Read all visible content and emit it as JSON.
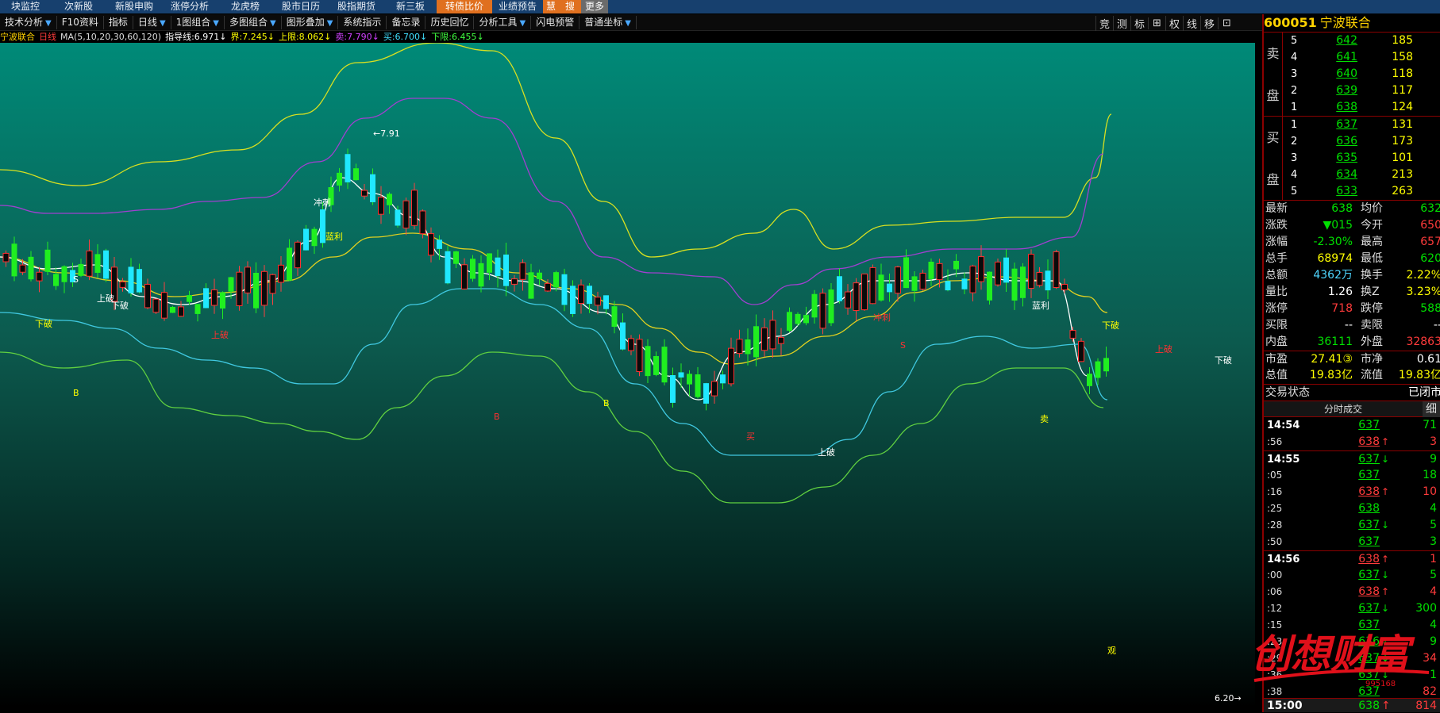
{
  "top_menu": [
    {
      "label": "块监控",
      "w": 64,
      "s": ""
    },
    {
      "label": "次新股",
      "w": 70,
      "s": ""
    },
    {
      "label": "新股申购",
      "w": 70,
      "s": ""
    },
    {
      "label": "涨停分析",
      "w": 70,
      "s": ""
    },
    {
      "label": "龙虎榜",
      "w": 70,
      "s": ""
    },
    {
      "label": "股市日历",
      "w": 70,
      "s": ""
    },
    {
      "label": "股指期货",
      "w": 70,
      "s": ""
    },
    {
      "label": "新三板",
      "w": 66,
      "s": ""
    },
    {
      "label": "转债比价",
      "w": 70,
      "s": "orange"
    },
    {
      "label": "业绩预告",
      "w": 64,
      "s": ""
    },
    {
      "label": "慧",
      "w": 20,
      "s": "orange"
    },
    {
      "label": "搜",
      "w": 28,
      "s": "orange"
    },
    {
      "label": "更多",
      "w": 34,
      "s": "gray"
    }
  ],
  "toolbar": [
    {
      "label": "技术分析",
      "arr": true
    },
    {
      "label": "F10资料",
      "arr": false
    },
    {
      "label": "指标",
      "arr": false
    },
    {
      "label": "日线",
      "arr": true
    },
    {
      "label": "1图组合",
      "arr": true
    },
    {
      "label": "多图组合",
      "arr": true
    },
    {
      "label": "图形叠加",
      "arr": true
    },
    {
      "label": "系统指示",
      "arr": false
    },
    {
      "label": "备忘录",
      "arr": false
    },
    {
      "label": "历史回忆",
      "arr": false
    },
    {
      "label": "分析工具",
      "arr": true
    },
    {
      "label": "闪电预警",
      "arr": false
    },
    {
      "label": "普通坐标",
      "arr": true
    }
  ],
  "right_tools": [
    "竞",
    "测",
    "标",
    "⊞",
    "权",
    "线",
    "移",
    "⊡"
  ],
  "indicator_bar": {
    "name": "宁波联合",
    "period": "日线",
    "ma": "MA(5,10,20,30,60,120)",
    "items": [
      {
        "label": "指导线:",
        "value": "6.971",
        "arrow": "↓",
        "color": "#ffffff"
      },
      {
        "label": "界:",
        "value": "7.245",
        "arrow": "↓",
        "color": "#ffff00"
      },
      {
        "label": "上限:",
        "value": "8.062",
        "arrow": "↓",
        "color": "#ffff00"
      },
      {
        "label": "卖:",
        "value": "7.790",
        "arrow": "↓",
        "color": "#d040ff"
      },
      {
        "label": "买:",
        "value": "6.700",
        "arrow": "↓",
        "color": "#40e0ff"
      },
      {
        "label": "下限:",
        "value": "6.455",
        "arrow": "↓",
        "color": "#40ff40"
      }
    ]
  },
  "chart_data": {
    "type": "candlestick",
    "symbol": "600051",
    "name": "宁波联合",
    "period": "日线",
    "annotations": {
      "high_marker": "7.91",
      "low_marker": "6.20",
      "labels": [
        "上破",
        "下破",
        "S",
        "B",
        "买",
        "卖",
        "冲刺",
        "蓝利",
        "观"
      ]
    },
    "ylim": [
      6.2,
      8.2
    ]
  },
  "quote": {
    "code": "600051",
    "name": "宁波联合",
    "sell": [
      {
        "i": "5",
        "p": "642",
        "v": "185"
      },
      {
        "i": "4",
        "p": "641",
        "v": "158"
      },
      {
        "i": "3",
        "p": "640",
        "v": "118"
      },
      {
        "i": "2",
        "p": "639",
        "v": "117"
      },
      {
        "i": "1",
        "p": "638",
        "v": "124"
      }
    ],
    "buy": [
      {
        "i": "1",
        "p": "637",
        "v": "131"
      },
      {
        "i": "2",
        "p": "636",
        "v": "173"
      },
      {
        "i": "3",
        "p": "635",
        "v": "101"
      },
      {
        "i": "4",
        "p": "634",
        "v": "213"
      },
      {
        "i": "5",
        "p": "633",
        "v": "263"
      }
    ],
    "sell_label": [
      "卖",
      "盘"
    ],
    "buy_label": [
      "买",
      "盘"
    ],
    "stats": [
      {
        "l1": "最新",
        "v1": "638",
        "c1": "green",
        "l2": "均价",
        "v2": "632",
        "c2": "green"
      },
      {
        "l1": "涨跌",
        "v1": "▼015",
        "c1": "green",
        "l2": "今开",
        "v2": "650",
        "c2": "red"
      },
      {
        "l1": "涨幅",
        "v1": "-2.30%",
        "c1": "green",
        "l2": "最高",
        "v2": "657",
        "c2": "red"
      },
      {
        "l1": "总手",
        "v1": "68974",
        "c1": "yellow",
        "l2": "最低",
        "v2": "620",
        "c2": "green"
      },
      {
        "l1": "总额",
        "v1": "4362万",
        "c1": "cyan",
        "l2": "换手",
        "v2": "2.22%",
        "c2": "yellow"
      },
      {
        "l1": "量比",
        "v1": "1.26",
        "c1": "white",
        "l2": "换Z",
        "v2": "3.23%",
        "c2": "yellow"
      },
      {
        "l1": "涨停",
        "v1": "718",
        "c1": "red",
        "l2": "跌停",
        "v2": "588",
        "c2": "green"
      },
      {
        "l1": "买限",
        "v1": "--",
        "c1": "white",
        "l2": "卖限",
        "v2": "--",
        "c2": "white"
      },
      {
        "l1": "内盘",
        "v1": "36111",
        "c1": "green",
        "l2": "外盘",
        "v2": "32863",
        "c2": "red"
      },
      {
        "l1": "市盈",
        "v1": "27.41③",
        "c1": "yellow",
        "l2": "市净",
        "v2": "0.61",
        "c2": "white"
      },
      {
        "l1": "总值",
        "v1": "19.83亿",
        "c1": "yellow",
        "l2": "流值",
        "v2": "19.83亿",
        "c2": "yellow"
      },
      {
        "l1": "交易状态",
        "v1": "",
        "c1": "white",
        "l2": "",
        "v2": "已闭市",
        "c2": "white"
      }
    ],
    "ticks_title": "分时成交",
    "ticks_btn": "细",
    "ticks": [
      {
        "t": "14:54",
        "big": true,
        "p": "637",
        "c": "green",
        "a": "",
        "v": "71",
        "vc": "green"
      },
      {
        "t": ":56",
        "big": false,
        "p": "638",
        "c": "red",
        "a": "↑",
        "v": "3",
        "vc": "red"
      },
      {
        "t": "14:55",
        "big": true,
        "p": "637",
        "c": "green",
        "a": "↓",
        "v": "9",
        "vc": "green"
      },
      {
        "t": ":05",
        "big": false,
        "p": "637",
        "c": "green",
        "a": "",
        "v": "18",
        "vc": "green"
      },
      {
        "t": ":16",
        "big": false,
        "p": "638",
        "c": "red",
        "a": "↑",
        "v": "10",
        "vc": "red"
      },
      {
        "t": ":25",
        "big": false,
        "p": "638",
        "c": "green",
        "a": "",
        "v": "4",
        "vc": "green"
      },
      {
        "t": ":28",
        "big": false,
        "p": "637",
        "c": "green",
        "a": "↓",
        "v": "5",
        "vc": "green"
      },
      {
        "t": ":50",
        "big": false,
        "p": "637",
        "c": "green",
        "a": "",
        "v": "3",
        "vc": "green"
      },
      {
        "t": "14:56",
        "big": true,
        "p": "638",
        "c": "red",
        "a": "↑",
        "v": "1",
        "vc": "red"
      },
      {
        "t": ":00",
        "big": false,
        "p": "637",
        "c": "green",
        "a": "↓",
        "v": "5",
        "vc": "green"
      },
      {
        "t": ":06",
        "big": false,
        "p": "638",
        "c": "red",
        "a": "↑",
        "v": "4",
        "vc": "red"
      },
      {
        "t": ":12",
        "big": false,
        "p": "637",
        "c": "green",
        "a": "↓",
        "v": "300",
        "vc": "green"
      },
      {
        "t": ":15",
        "big": false,
        "p": "637",
        "c": "green",
        "a": "",
        "v": "4",
        "vc": "green"
      },
      {
        "t": ":23",
        "big": false,
        "p": "636",
        "c": "green",
        "a": "↓",
        "v": "9",
        "vc": "green"
      },
      {
        "t": ":29",
        "big": false,
        "p": "637",
        "c": "green",
        "a": "↓",
        "v": "34",
        "vc": "red"
      },
      {
        "t": ":36",
        "big": false,
        "p": "637",
        "c": "green",
        "a": "↓",
        "v": "1",
        "vc": "green"
      },
      {
        "t": ":38",
        "big": false,
        "p": "637",
        "c": "green",
        "a": "",
        "v": "82",
        "vc": "red"
      }
    ],
    "bottom": {
      "t": "15:00",
      "p": "638",
      "a": "↑",
      "v": "814"
    }
  },
  "watermark": {
    "text": "创想财富",
    "sub": "995168"
  }
}
